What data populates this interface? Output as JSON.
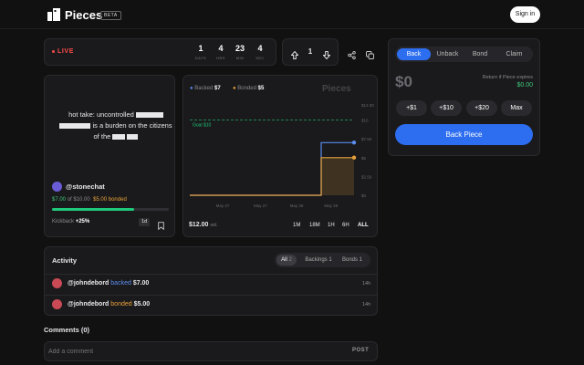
{
  "brand": {
    "name": "Pieces",
    "badge": "BETA"
  },
  "header": {
    "signin_label": "Sign in"
  },
  "status": {
    "live_label": "LIVE"
  },
  "timer": [
    {
      "value": "1",
      "label": "DAYS"
    },
    {
      "value": "4",
      "label": "HRS"
    },
    {
      "value": "23",
      "label": "MIN"
    },
    {
      "value": "4",
      "label": "SEC"
    }
  ],
  "votes": {
    "count": "1"
  },
  "piece": {
    "text_1": "hot take: uncontrolled",
    "text_2": "is a burden on the citizens",
    "text_3": "of the",
    "author": "@stonechat",
    "backed": "$7.00",
    "of_label": "of",
    "goal": "$10.00",
    "bonded": "$5.00 bonded",
    "progress": 0.7,
    "kickback_label": "Kickback",
    "kickback_value": "+25%",
    "duration": "1d"
  },
  "chart_data": {
    "type": "line",
    "legend": [
      {
        "name": "Backed",
        "value": "$7",
        "color": "#5b8def"
      },
      {
        "name": "Bonded",
        "value": "$5",
        "color": "#e8a13a"
      }
    ],
    "x_ticks": [
      "May 27",
      "May 27",
      "May 28",
      "May 28"
    ],
    "y_ticks": [
      "$12.00",
      "$10",
      "$7.50",
      "$5",
      "$2.50",
      "$0"
    ],
    "goal_label": "Goal $10",
    "goal": 10,
    "ylim": [
      0,
      12
    ],
    "series": [
      {
        "name": "Backed",
        "x": [
          0,
          0.8,
          0.8,
          1
        ],
        "values": [
          0,
          0,
          7,
          7
        ]
      },
      {
        "name": "Bonded",
        "x": [
          0,
          0.8,
          0.8,
          1
        ],
        "values": [
          0,
          0,
          5,
          5
        ]
      }
    ],
    "current_value": "$12.00",
    "current_value_unit": "vol.",
    "ranges": [
      "1M",
      "18M",
      "1H",
      "6H",
      "ALL"
    ],
    "selected_range": "ALL"
  },
  "activity": {
    "title": "Activity",
    "tabs": [
      {
        "label": "All",
        "count": "2"
      },
      {
        "label": "Backings",
        "count": "1"
      },
      {
        "label": "Bonds",
        "count": "1"
      }
    ],
    "rows": [
      {
        "user": "@johndebord",
        "action": "backed",
        "amount": "$7.00",
        "time": "14h",
        "action_color": "#5b8def"
      },
      {
        "user": "@johndebord",
        "action": "bonded",
        "amount": "$5.00",
        "time": "14h",
        "action_color": "#e8a13a"
      }
    ]
  },
  "comments": {
    "title": "Comments (0)",
    "placeholder": "Add a comment",
    "post_label": "POST"
  },
  "trade": {
    "tabs": [
      "Back",
      "Unback",
      "Bond",
      "Claim"
    ],
    "active_tab": "Back",
    "amount": "$0",
    "return_label": "Return if Piece expires",
    "return_value": "$0.00",
    "quick_amounts": [
      "+$1",
      "+$10",
      "+$20",
      "Max"
    ],
    "submit_label": "Back Piece"
  }
}
